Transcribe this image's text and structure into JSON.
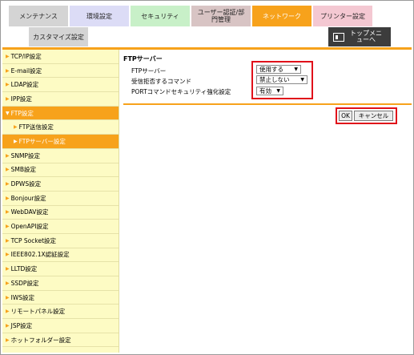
{
  "tabs": [
    {
      "label": "メンテナンス"
    },
    {
      "label": "環境設定"
    },
    {
      "label": "セキュリティ"
    },
    {
      "label": "ユーザー認証/部門管理"
    },
    {
      "label": "ネットワーク"
    },
    {
      "label": "プリンター設定"
    }
  ],
  "active_tab": "ネットワーク",
  "subtab": {
    "label": "カスタマイズ設定"
  },
  "topmenu": {
    "label": "トップメニューへ"
  },
  "sidebar": {
    "items": [
      {
        "label": "TCP/IP設定"
      },
      {
        "label": "E-mail設定"
      },
      {
        "label": "LDAP設定"
      },
      {
        "label": "IPP設定"
      },
      {
        "label": "FTP設定"
      },
      {
        "label": "FTP送信設定"
      },
      {
        "label": "FTPサーバー設定"
      },
      {
        "label": "SNMP設定"
      },
      {
        "label": "SMB設定"
      },
      {
        "label": "DPWS設定"
      },
      {
        "label": "Bonjour設定"
      },
      {
        "label": "WebDAV設定"
      },
      {
        "label": "OpenAPI設定"
      },
      {
        "label": "TCP Socket設定"
      },
      {
        "label": "IEEE802.1X認証設定"
      },
      {
        "label": "LLTD設定"
      },
      {
        "label": "SSDP設定"
      },
      {
        "label": "IWS設定"
      },
      {
        "label": "リモートパネル設定"
      },
      {
        "label": "JSP設定"
      },
      {
        "label": "ホットフォルダー設定"
      }
    ]
  },
  "content": {
    "title": "FTPサーバー",
    "settings": [
      {
        "label": "FTPサーバー",
        "value": "使用する"
      },
      {
        "label": "受信拒否するコマンド",
        "value": "禁止しない"
      },
      {
        "label": "PORTコマンドセキュリティ強化設定",
        "value": "有効"
      }
    ],
    "ok_label": "OK",
    "cancel_label": "キャンセル"
  },
  "colors": {
    "accent": "#f7a21b",
    "sidebar_bg": "#fdfbc4",
    "highlight": "#e0101a"
  }
}
